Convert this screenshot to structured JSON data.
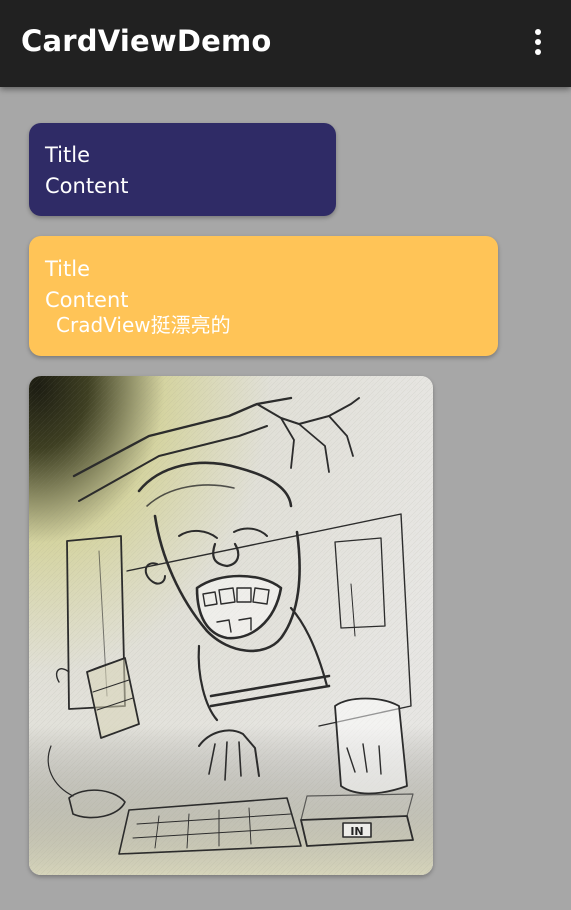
{
  "app_bar": {
    "title": "CardViewDemo",
    "background": "#212121",
    "overflow_icon": "more-vert-icon"
  },
  "cards": [
    {
      "title": "Title",
      "content": "Content",
      "color": "#2F2B66"
    },
    {
      "title": "Title",
      "content": "Content",
      "extra": "CradView挺漂亮的",
      "color": "#FFC457"
    },
    {
      "image": "pencil-sketch-illustration",
      "sign_text": "IN"
    }
  ],
  "colors": {
    "page_background": "#A7A7A7",
    "text": "#FFFFFF"
  }
}
